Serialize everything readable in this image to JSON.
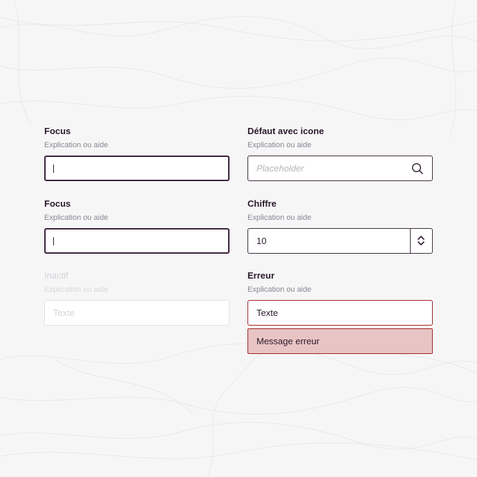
{
  "fields": [
    {
      "label": "Focus",
      "help": "Explication ou aide",
      "value": "",
      "state": "focus"
    },
    {
      "label": "Défaut avec icone",
      "help": "Explication ou aide",
      "placeholder": "Placeholder",
      "icon": "search-icon",
      "state": "default"
    },
    {
      "label": "Focus",
      "help": "Explication ou aide",
      "value": "",
      "state": "focus"
    },
    {
      "label": "Chiffre",
      "help": "Explication ou aide",
      "value": "10",
      "icon": "chevron-up-down-icon",
      "state": "default"
    },
    {
      "label": "Inactif",
      "help": "Explication ou aide",
      "placeholder": "Texte",
      "state": "disabled"
    },
    {
      "label": "Erreur",
      "help": "Explication ou aide",
      "value": "Texte",
      "error_message": "Message erreur",
      "state": "error"
    }
  ],
  "colors": {
    "focus_border": "#3a1f3c",
    "default_border": "#3b2a3d",
    "error_border": "#9c2323",
    "error_background": "#e9c4c4",
    "disabled_text": "#d6d2d8"
  }
}
